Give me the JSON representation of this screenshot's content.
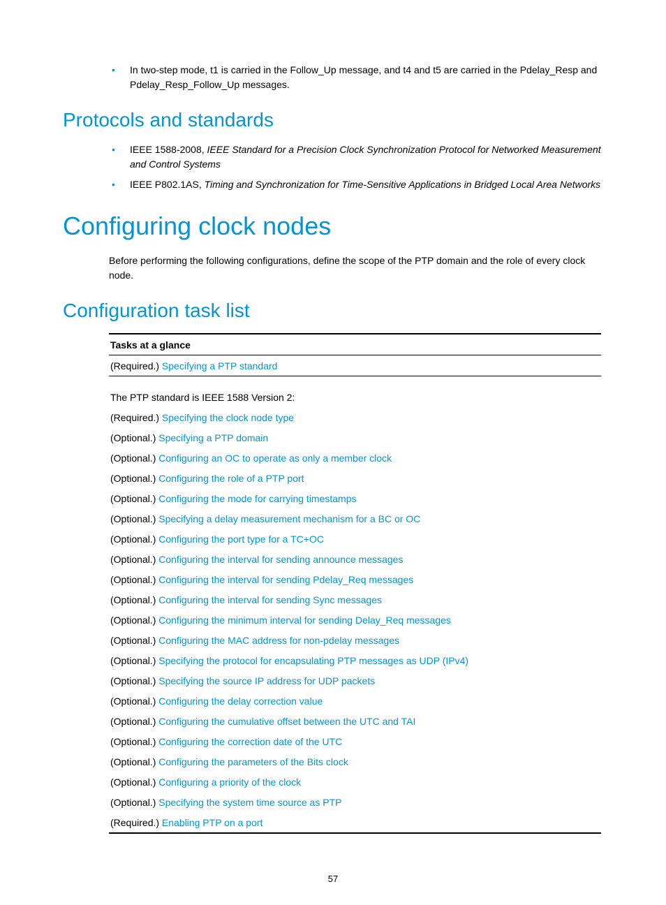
{
  "intro_bullet": "In two-step mode, t1 is carried in the Follow_Up message, and t4 and t5 are carried in the Pdelay_Resp and Pdelay_Resp_Follow_Up messages.",
  "protocols_heading": "Protocols and standards",
  "protocols": [
    {
      "prefix": "IEEE 1588-2008, ",
      "italic": "IEEE Standard for a Precision Clock Synchronization Protocol for Networked Measurement and Control Systems"
    },
    {
      "prefix": "IEEE P802.1AS, ",
      "italic": "Timing and Synchronization for Time-Sensitive Applications in Bridged Local Area Networks"
    }
  ],
  "configuring_heading": "Configuring clock nodes",
  "configuring_body": "Before performing the following configurations, define the scope of the PTP domain and the role of every clock node.",
  "tasklist_heading": "Configuration task list",
  "table_header": "Tasks at a glance",
  "note_text": "The PTP standard is IEEE 1588 Version 2:",
  "tasks": [
    {
      "req": "(Required.) ",
      "link": "Specifying a PTP standard"
    },
    {
      "req": "(Required.) ",
      "link": "Specifying the clock node type"
    },
    {
      "req": "(Optional.) ",
      "link": "Specifying a PTP domain"
    },
    {
      "req": "(Optional.) ",
      "link": "Configuring an OC to operate as only a member clock"
    },
    {
      "req": "(Optional.) ",
      "link": "Configuring the role of a PTP port"
    },
    {
      "req": "(Optional.) ",
      "link": "Configuring the mode for carrying timestamps"
    },
    {
      "req": "(Optional.) ",
      "link": "Specifying a delay measurement mechanism for a BC or OC"
    },
    {
      "req": "(Optional.) ",
      "link": "Configuring the port type for a TC+OC"
    },
    {
      "req": "(Optional.) ",
      "link": "Configuring the interval for sending announce messages"
    },
    {
      "req": "(Optional.) ",
      "link": "Configuring the interval for sending Pdelay_Req messages"
    },
    {
      "req": "(Optional.) ",
      "link": "Configuring the interval for sending Sync messages"
    },
    {
      "req": "(Optional.) ",
      "link": "Configuring the minimum interval for sending Delay_Req messages"
    },
    {
      "req": "(Optional.) ",
      "link": "Configuring the MAC address for non-pdelay messages"
    },
    {
      "req": "(Optional.) ",
      "link": "Specifying the protocol for encapsulating PTP messages as UDP (IPv4)"
    },
    {
      "req": "(Optional.) ",
      "link": "Specifying the source IP address for UDP packets"
    },
    {
      "req": "(Optional.) ",
      "link": "Configuring the delay correction value"
    },
    {
      "req": "(Optional.) ",
      "link": "Configuring the cumulative offset between the UTC and TAI"
    },
    {
      "req": "(Optional.) ",
      "link": "Configuring the correction date of the UTC"
    },
    {
      "req": "(Optional.) ",
      "link": "Configuring the parameters of the Bits clock"
    },
    {
      "req": "(Optional.) ",
      "link": "Configuring a priority of the clock"
    },
    {
      "req": "(Optional.) ",
      "link": "Specifying the system time source as PTP"
    },
    {
      "req": "(Required.) ",
      "link": "Enabling PTP on a port"
    }
  ],
  "page_number": "57"
}
